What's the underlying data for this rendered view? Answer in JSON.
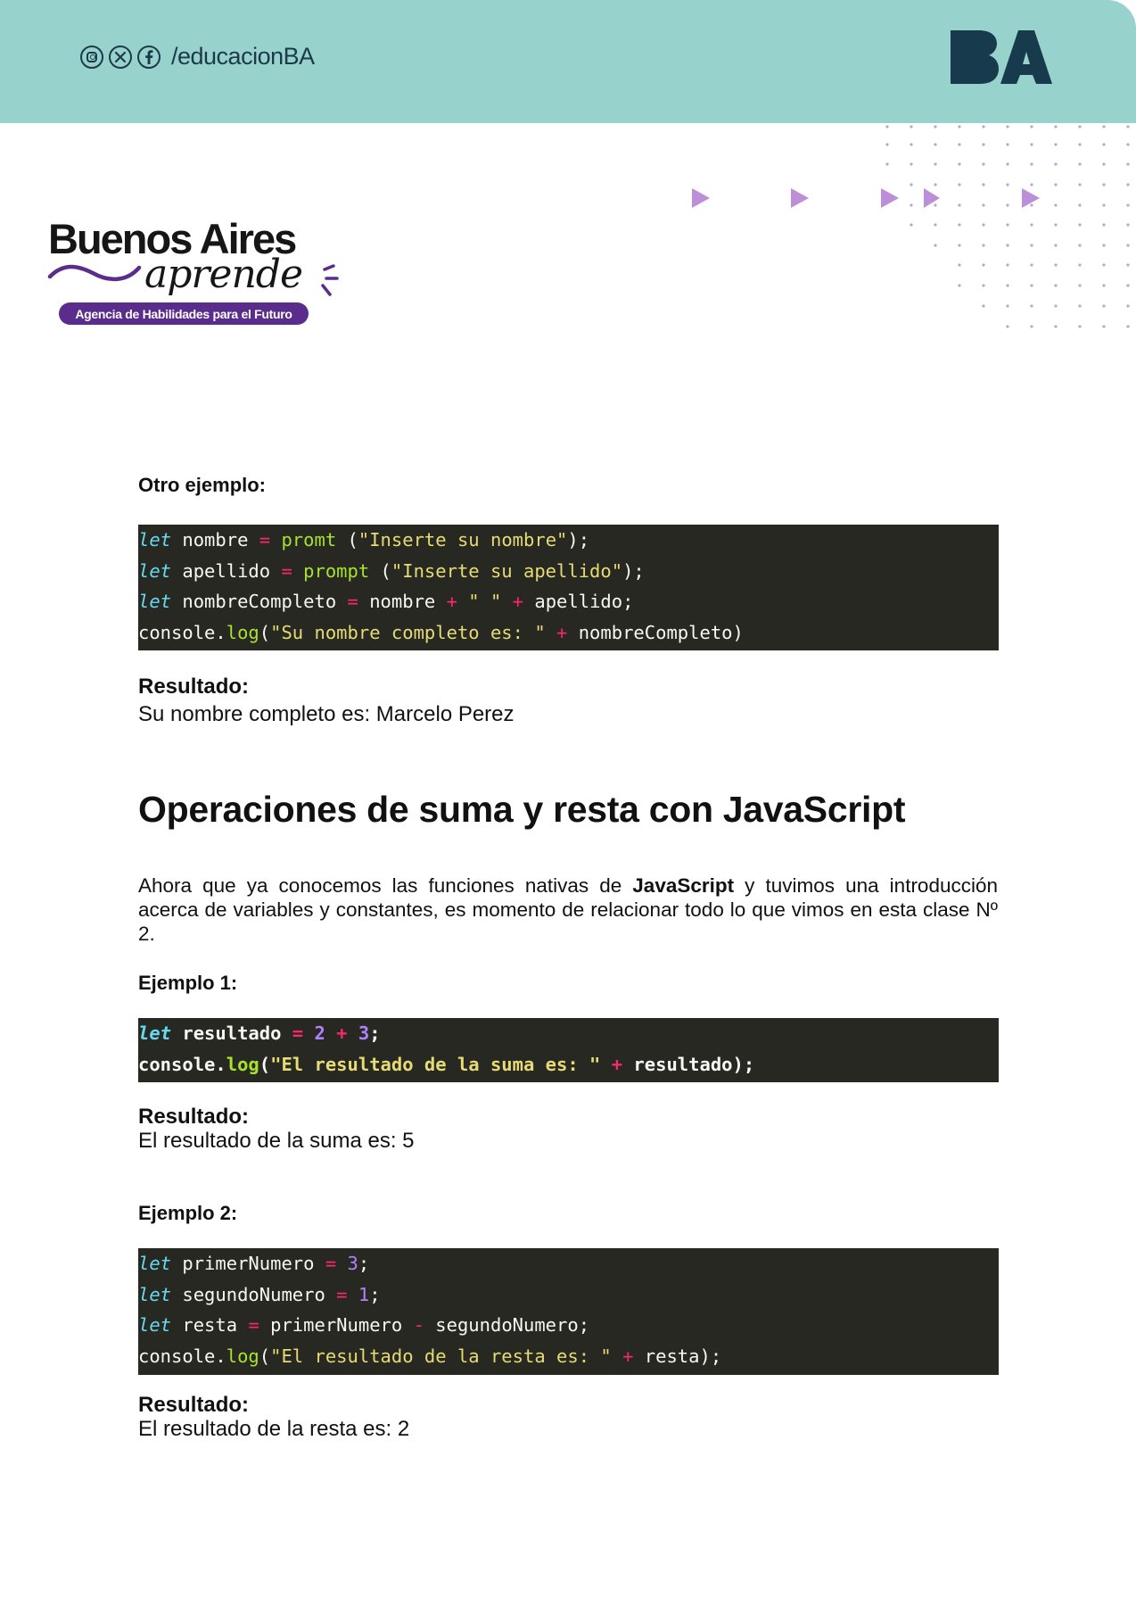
{
  "header": {
    "social_handle": "/educacionBA",
    "logo_text": "BA",
    "background_color": "#97d2cd",
    "icons": [
      "instagram-icon",
      "x-icon",
      "facebook-icon"
    ]
  },
  "brand": {
    "line1": "Buenos Aires",
    "line2": "aprende",
    "tagline": "Agencia de Habilidades para el Futuro"
  },
  "section1": {
    "label": "Otro ejemplo:",
    "code": [
      [
        [
          "kw",
          "let"
        ],
        [
          "p",
          " nombre "
        ],
        [
          "op",
          "="
        ],
        [
          "p",
          " "
        ],
        [
          "fn",
          "promt"
        ],
        [
          "p",
          " ("
        ],
        [
          "str",
          "\"Inserte su nombre\""
        ],
        [
          "p",
          ");"
        ]
      ],
      [
        [
          "kw",
          "let"
        ],
        [
          "p",
          " apellido "
        ],
        [
          "op",
          "="
        ],
        [
          "p",
          " "
        ],
        [
          "fn",
          "prompt"
        ],
        [
          "p",
          " ("
        ],
        [
          "str",
          "\"Inserte su apellido\""
        ],
        [
          "p",
          ");"
        ]
      ],
      [
        [
          "kw",
          "let"
        ],
        [
          "p",
          " nombreCompleto "
        ],
        [
          "op",
          "="
        ],
        [
          "p",
          " nombre "
        ],
        [
          "op",
          "+"
        ],
        [
          "p",
          " "
        ],
        [
          "str",
          "\" \""
        ],
        [
          "p",
          " "
        ],
        [
          "op",
          "+"
        ],
        [
          "p",
          " apellido;"
        ]
      ],
      [
        [
          "p",
          "console."
        ],
        [
          "fn",
          "log"
        ],
        [
          "p",
          "("
        ],
        [
          "str",
          "\"Su nombre completo es: \""
        ],
        [
          "p",
          " "
        ],
        [
          "op",
          "+"
        ],
        [
          "p",
          " nombreCompleto)"
        ]
      ]
    ],
    "result_label": "Resultado:",
    "result_text": "Su nombre completo es: Marcelo Perez"
  },
  "section_title": "Operaciones de suma y resta con JavaScript",
  "intro": {
    "before": "Ahora que ya conocemos las funciones nativas de ",
    "bold": "JavaScript",
    "after": " y tuvimos una introducción acerca de variables y constantes, es momento de relacionar todo lo que vimos en esta clase Nº 2."
  },
  "example1": {
    "label": "Ejemplo 1:",
    "code": [
      [
        [
          "kw",
          "let"
        ],
        [
          "p",
          " resultado "
        ],
        [
          "op",
          "="
        ],
        [
          "p",
          " "
        ],
        [
          "num",
          "2"
        ],
        [
          "p",
          " "
        ],
        [
          "op",
          "+"
        ],
        [
          "p",
          " "
        ],
        [
          "num",
          "3"
        ],
        [
          "p",
          ";"
        ]
      ],
      [
        [
          "p",
          "console."
        ],
        [
          "fn",
          "log"
        ],
        [
          "p",
          "("
        ],
        [
          "str",
          "\"El resultado de la suma es: \""
        ],
        [
          "p",
          " "
        ],
        [
          "op",
          "+"
        ],
        [
          "p",
          " resultado);"
        ]
      ]
    ],
    "result_label": "Resultado:",
    "result_text": "El resultado de la suma es: 5"
  },
  "example2": {
    "label": "Ejemplo 2:",
    "code": [
      [
        [
          "kw",
          "let"
        ],
        [
          "p",
          " primerNumero "
        ],
        [
          "op",
          "="
        ],
        [
          "p",
          " "
        ],
        [
          "num",
          "3"
        ],
        [
          "p",
          ";"
        ]
      ],
      [
        [
          "kw",
          "let"
        ],
        [
          "p",
          " segundoNumero "
        ],
        [
          "op",
          "="
        ],
        [
          "p",
          " "
        ],
        [
          "num",
          "1"
        ],
        [
          "p",
          ";"
        ]
      ],
      [
        [
          "kw",
          "let"
        ],
        [
          "p",
          " resta "
        ],
        [
          "op",
          "="
        ],
        [
          "p",
          " primerNumero "
        ],
        [
          "op",
          "-"
        ],
        [
          "p",
          " segundoNumero;"
        ]
      ],
      [
        [
          "p",
          "console."
        ],
        [
          "fn",
          "log"
        ],
        [
          "p",
          "("
        ],
        [
          "str",
          "\"El resultado de la resta es: \""
        ],
        [
          "p",
          " "
        ],
        [
          "op",
          "+"
        ],
        [
          "p",
          " resta);"
        ]
      ]
    ],
    "result_label": "Resultado:",
    "result_text": "El resultado de la resta es: 2"
  }
}
